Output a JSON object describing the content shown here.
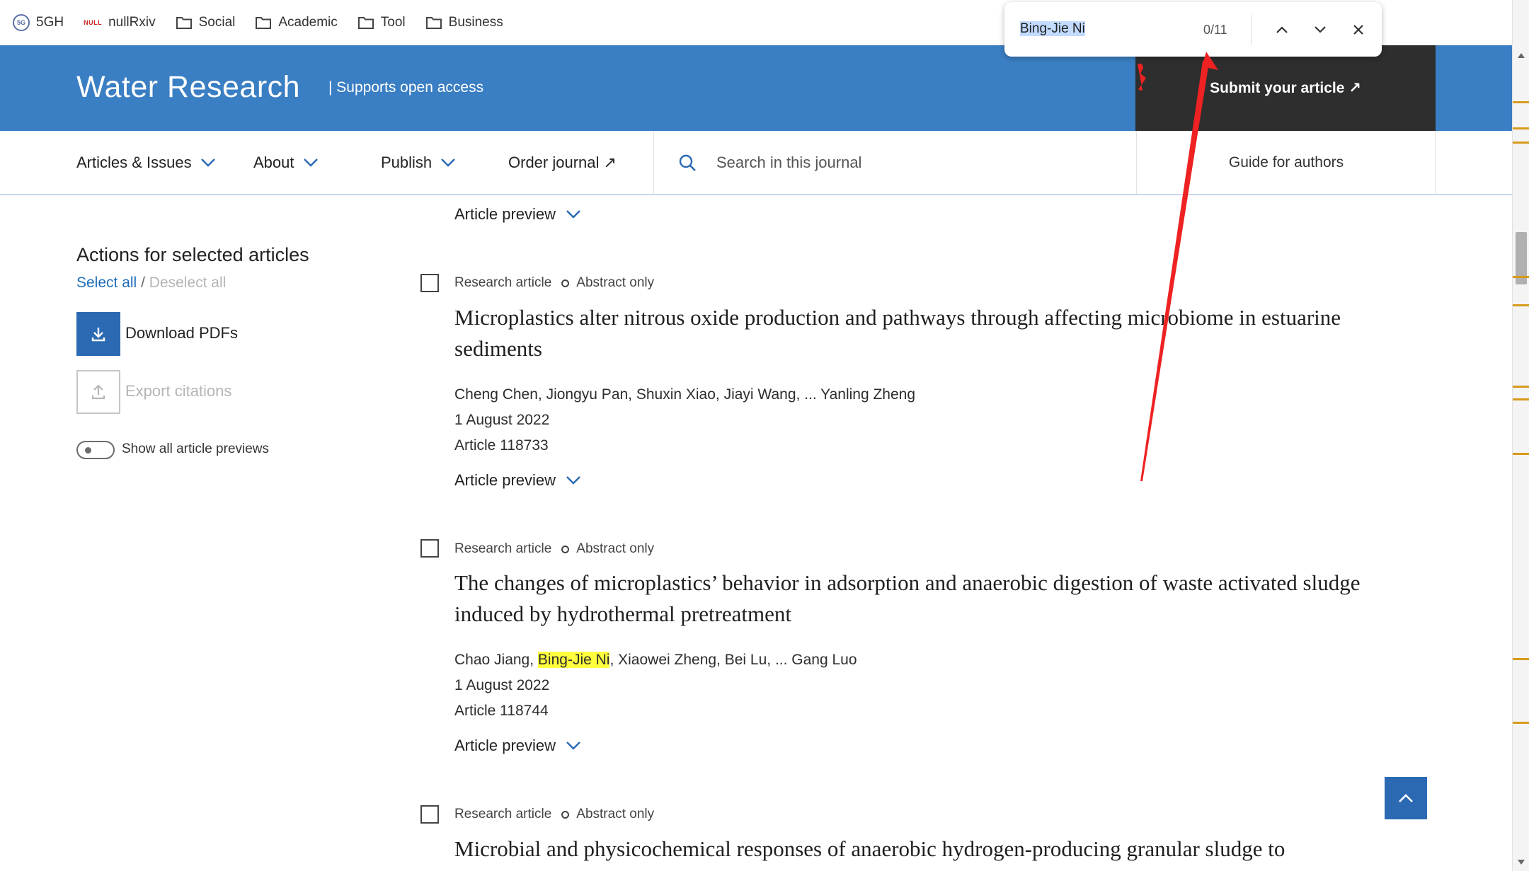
{
  "bookmarks": [
    {
      "label": "5GH",
      "icon": "site-logo-icon"
    },
    {
      "label": "nullRxiv",
      "icon": "null-logo-icon"
    },
    {
      "label": "Social",
      "icon": "folder-icon"
    },
    {
      "label": "Academic",
      "icon": "folder-icon"
    },
    {
      "label": "Tool",
      "icon": "folder-icon"
    },
    {
      "label": "Business",
      "icon": "folder-icon"
    }
  ],
  "null_logo_text": "NULL",
  "find": {
    "query": "Bing-Jie Ni",
    "count": "0/11"
  },
  "journal": {
    "title": "Water Research",
    "subtitle": "| Supports open access",
    "submit": "Submit your article ↗"
  },
  "nav": {
    "articles": "Articles & Issues",
    "about": "About",
    "publish": "Publish",
    "order": "Order journal ↗",
    "search_placeholder": "Search in this journal",
    "guide": "Guide for authors"
  },
  "sidebar": {
    "title": "Actions for selected articles",
    "select_all": "Select all",
    "separator": "/",
    "deselect_all": "Deselect all",
    "download": "Download PDFs",
    "export": "Export citations",
    "toggle_label": "Show all article previews"
  },
  "preview_label": "Article preview",
  "articles": [
    {
      "type": "Research article",
      "access": "Abstract only",
      "title_1": "Microplastics alter nitrous oxide production and pathways through affecting microbiome in estuarine",
      "title_2": "sediments",
      "authors": "Cheng Chen, Jiongyu Pan, Shuxin Xiao, Jiayi Wang, ... Yanling Zheng",
      "date": "1 August 2022",
      "article_no": "Article 118733"
    },
    {
      "type": "Research article",
      "access": "Abstract only",
      "title_1": "The changes of microplastics’ behavior in adsorption and anaerobic digestion of waste activated sludge",
      "title_2": "induced by hydrothermal pretreatment",
      "authors_before": "Chao Jiang, ",
      "authors_highlight": "Bing-Jie Ni",
      "authors_after": ", Xiaowei Zheng, Bei Lu, ... Gang Luo",
      "date": "1 August 2022",
      "article_no": "Article 118744"
    },
    {
      "type": "Research article",
      "access": "Abstract only",
      "title_1": "Microbial and physicochemical responses of anaerobic hydrogen-producing granular sludge to"
    }
  ],
  "colors": {
    "brand_blue": "#3a7ec3",
    "submit_dark": "#2e2e2e",
    "link_blue": "#1e6eb8",
    "highlight": "#ffff3d",
    "annotation_red": "#ee2222",
    "scroll_marker": "#d89a1c"
  }
}
